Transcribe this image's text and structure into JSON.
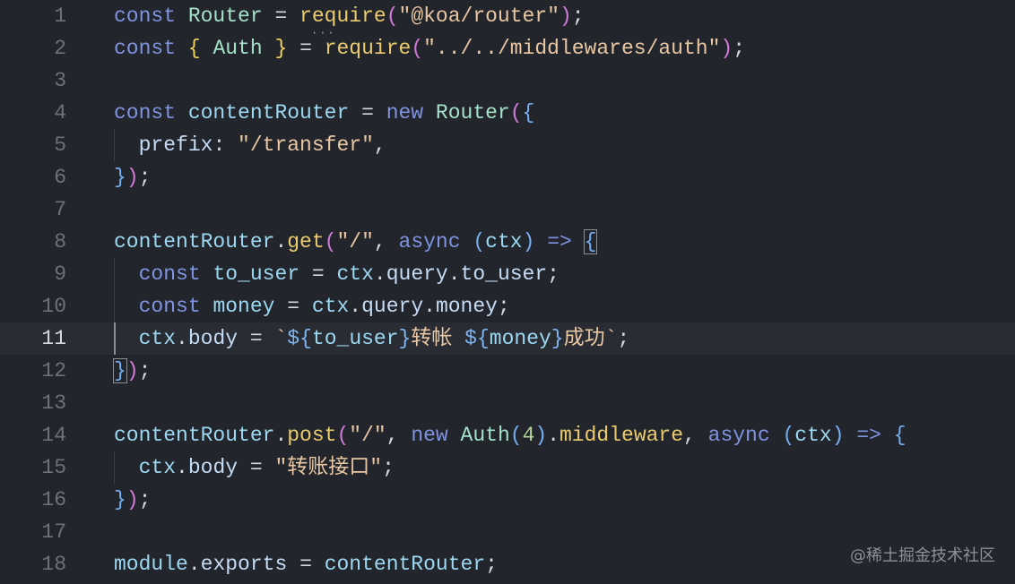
{
  "editor": {
    "line_numbers": [
      "1",
      "2",
      "3",
      "4",
      "5",
      "6",
      "7",
      "8",
      "9",
      "10",
      "11",
      "12",
      "13",
      "14",
      "15",
      "16",
      "17",
      "18"
    ],
    "lines": [
      [
        [
          "k",
          "const "
        ],
        [
          "n",
          "Router"
        ],
        [
          "p",
          " = "
        ],
        [
          "f",
          "require"
        ],
        [
          "b2",
          "("
        ],
        [
          "s",
          "\"@koa/router\""
        ],
        [
          "b2",
          ")"
        ],
        [
          "p",
          ";"
        ]
      ],
      [
        [
          "k",
          "const "
        ],
        [
          "b1",
          "{ "
        ],
        [
          "n",
          "Auth"
        ],
        [
          "b1",
          " }"
        ],
        [
          "p",
          " = "
        ],
        [
          "f",
          "require"
        ],
        [
          "b2",
          "("
        ],
        [
          "s",
          "\"../../middlewares/auth\""
        ],
        [
          "b2",
          ")"
        ],
        [
          "p",
          ";"
        ]
      ],
      [],
      [
        [
          "k",
          "const "
        ],
        [
          "v",
          "contentRouter"
        ],
        [
          "p",
          " = "
        ],
        [
          "k",
          "new "
        ],
        [
          "n",
          "Router"
        ],
        [
          "b2",
          "("
        ],
        [
          "b3",
          "{"
        ]
      ],
      [
        [
          "p",
          "  "
        ],
        [
          "prop",
          "prefix"
        ],
        [
          "p",
          ": "
        ],
        [
          "s",
          "\"/transfer\""
        ],
        [
          "p",
          ","
        ]
      ],
      [
        [
          "b3",
          "}"
        ],
        [
          "b2",
          ")"
        ],
        [
          "p",
          ";"
        ]
      ],
      [],
      [
        [
          "v",
          "contentRouter"
        ],
        [
          "p",
          "."
        ],
        [
          "f",
          "get"
        ],
        [
          "b2",
          "("
        ],
        [
          "s",
          "\"/\""
        ],
        [
          "p",
          ", "
        ],
        [
          "k",
          "async "
        ],
        [
          "b3",
          "("
        ],
        [
          "v",
          "ctx"
        ],
        [
          "b3",
          ")"
        ],
        [
          "k",
          " => "
        ],
        [
          "b3box",
          "{"
        ]
      ],
      [
        [
          "p",
          "  "
        ],
        [
          "k",
          "const "
        ],
        [
          "v",
          "to_user"
        ],
        [
          "p",
          " = "
        ],
        [
          "v",
          "ctx"
        ],
        [
          "p",
          "."
        ],
        [
          "prop",
          "query"
        ],
        [
          "p",
          "."
        ],
        [
          "prop",
          "to_user"
        ],
        [
          "p",
          ";"
        ]
      ],
      [
        [
          "p",
          "  "
        ],
        [
          "k",
          "const "
        ],
        [
          "v",
          "money"
        ],
        [
          "p",
          " = "
        ],
        [
          "v",
          "ctx"
        ],
        [
          "p",
          "."
        ],
        [
          "prop",
          "query"
        ],
        [
          "p",
          "."
        ],
        [
          "prop",
          "money"
        ],
        [
          "p",
          ";"
        ]
      ],
      [
        [
          "p",
          "  "
        ],
        [
          "v",
          "ctx"
        ],
        [
          "p",
          "."
        ],
        [
          "prop",
          "body"
        ],
        [
          "p",
          " = "
        ],
        [
          "s",
          "`"
        ],
        [
          "tpl",
          "${"
        ],
        [
          "v",
          "to_user"
        ],
        [
          "tpl",
          "}"
        ],
        [
          "s",
          "转帐 "
        ],
        [
          "tpl",
          "${"
        ],
        [
          "v",
          "money"
        ],
        [
          "tpl",
          "}"
        ],
        [
          "s",
          "成功`"
        ],
        [
          "p",
          ";"
        ]
      ],
      [
        [
          "b3box",
          "}"
        ],
        [
          "b2",
          ")"
        ],
        [
          "p",
          ";"
        ]
      ],
      [],
      [
        [
          "v",
          "contentRouter"
        ],
        [
          "p",
          "."
        ],
        [
          "f",
          "post"
        ],
        [
          "b2",
          "("
        ],
        [
          "s",
          "\"/\""
        ],
        [
          "p",
          ", "
        ],
        [
          "k",
          "new "
        ],
        [
          "n",
          "Auth"
        ],
        [
          "b3",
          "("
        ],
        [
          "num",
          "4"
        ],
        [
          "b3",
          ")"
        ],
        [
          "p",
          "."
        ],
        [
          "f",
          "middleware"
        ],
        [
          "p",
          ", "
        ],
        [
          "k",
          "async "
        ],
        [
          "b3",
          "("
        ],
        [
          "v",
          "ctx"
        ],
        [
          "b3",
          ")"
        ],
        [
          "k",
          " => "
        ],
        [
          "b3",
          "{"
        ]
      ],
      [
        [
          "p",
          "  "
        ],
        [
          "v",
          "ctx"
        ],
        [
          "p",
          "."
        ],
        [
          "prop",
          "body"
        ],
        [
          "p",
          " = "
        ],
        [
          "s",
          "\"转账接口\""
        ],
        [
          "p",
          ";"
        ]
      ],
      [
        [
          "b3",
          "}"
        ],
        [
          "b2",
          ")"
        ],
        [
          "p",
          ";"
        ]
      ],
      [],
      [
        [
          "v",
          "module"
        ],
        [
          "p",
          "."
        ],
        [
          "prop",
          "exports"
        ],
        [
          "p",
          " = "
        ],
        [
          "v",
          "contentRouter"
        ],
        [
          "p",
          ";"
        ]
      ]
    ],
    "active_line": 11,
    "guide_lines": [
      5,
      9,
      10,
      11,
      15
    ]
  },
  "watermark": "@稀土掘金技术社区"
}
